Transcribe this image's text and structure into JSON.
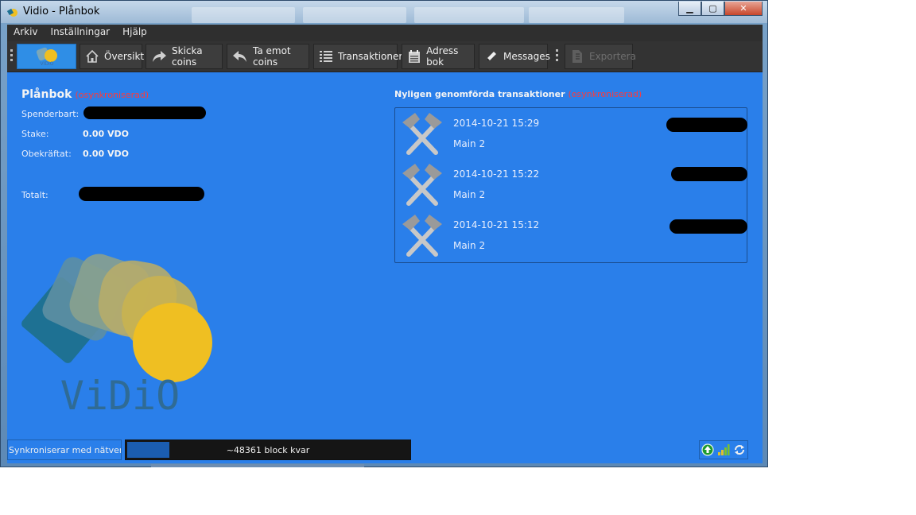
{
  "window": {
    "title": "Vidio - Plånbok",
    "controls": {
      "minimize": "▁",
      "maximize": "▢",
      "close": "✕"
    }
  },
  "menu": {
    "items": [
      {
        "label": "Arkiv"
      },
      {
        "label": "Inställningar"
      },
      {
        "label": "Hjälp"
      }
    ]
  },
  "toolbar": {
    "logo_text": "VIDIO",
    "overview": "Översikt",
    "send": "Skicka coins",
    "receive": "Ta emot coins",
    "transactions": "Transaktioner",
    "addressbook": "Adress bok",
    "messages": "Messages",
    "export": "Exportera"
  },
  "wallet": {
    "title": "Plånbok",
    "unsynced": "(osynkroniserad)",
    "spendable_label": "Spenderbart:",
    "stake_label": "Stake:",
    "stake_value": "0.00 VDO",
    "unconfirmed_label": "Obekräftat:",
    "unconfirmed_value": "0.00 VDO",
    "total_label": "Totalt:"
  },
  "recent": {
    "title": "Nyligen genomförda transaktioner",
    "unsynced": "(osynkroniserad)",
    "items": [
      {
        "date": "2014-10-21 15:29",
        "label": "Main 2"
      },
      {
        "date": "2014-10-21 15:22",
        "label": "Main 2"
      },
      {
        "date": "2014-10-21 15:12",
        "label": "Main 2"
      }
    ]
  },
  "brand": {
    "wordmark": "ViDiO"
  },
  "status": {
    "sync_label": "Synkroniserar med nätverk...",
    "progress_text": "~48361 block kvar",
    "progress": 0.15
  },
  "colors": {
    "main_bg": "#2a7fea",
    "toolbar_bg": "#333333",
    "unsynced": "#ff3a3a",
    "logo_yellow": "#efbf22",
    "logo_teal": "#1e7193"
  }
}
